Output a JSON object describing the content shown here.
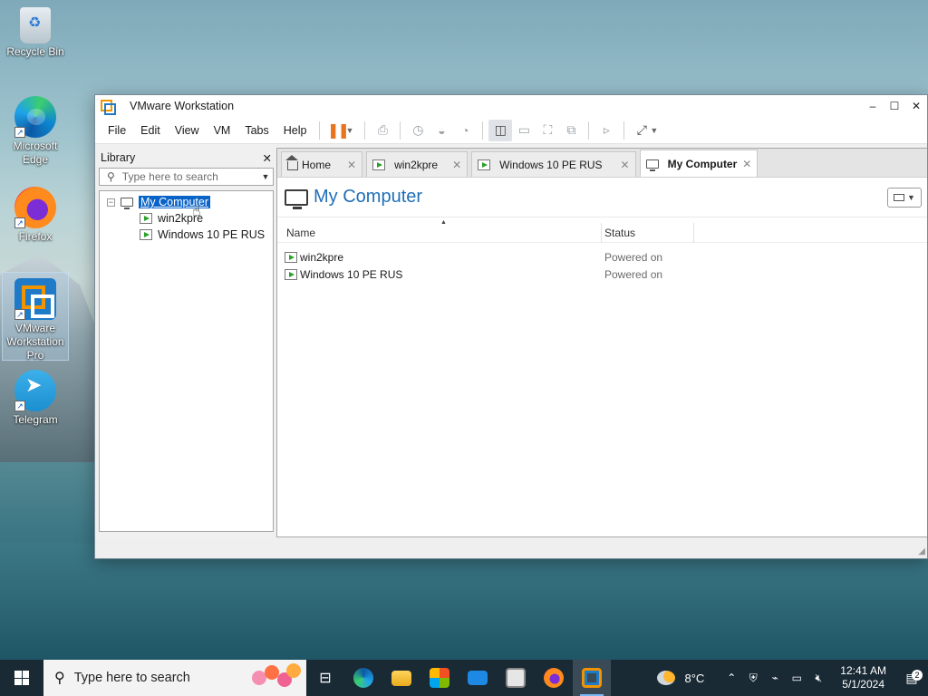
{
  "desktop": {
    "icons": [
      {
        "label": "Recycle Bin"
      },
      {
        "label": "Microsoft Edge"
      },
      {
        "label": "Firefox"
      },
      {
        "label": "VMware Workstation Pro"
      },
      {
        "label": "Telegram"
      }
    ]
  },
  "window": {
    "title": "VMware Workstation",
    "controls": {
      "minimize": "–",
      "maximize": "☐",
      "close": "✕"
    }
  },
  "menu": [
    "File",
    "Edit",
    "View",
    "VM",
    "Tabs",
    "Help"
  ],
  "library": {
    "title": "Library",
    "close": "✕",
    "search_placeholder": "Type here to search",
    "tree": {
      "root": "My Computer",
      "children": [
        "win2kpre",
        "Windows 10 PE RUS"
      ]
    }
  },
  "tabs": [
    {
      "label": "Home",
      "close": "✕"
    },
    {
      "label": "win2kpre",
      "close": "✕"
    },
    {
      "label": "Windows 10 PE RUS",
      "close": "✕"
    },
    {
      "label": "My Computer",
      "close": "✕",
      "active": true
    }
  ],
  "page": {
    "title": "My Computer",
    "columns": [
      "Name",
      "Status"
    ],
    "rows": [
      {
        "name": "win2kpre",
        "status": "Powered on"
      },
      {
        "name": "Windows 10 PE RUS",
        "status": "Powered on"
      }
    ]
  },
  "taskbar": {
    "search_placeholder": "Type here to search",
    "weather_temp": "8°C",
    "time": "12:41 AM",
    "date": "5/1/2024",
    "notification_count": "2"
  },
  "colors": {
    "accent": "#1f6fb8",
    "selection": "#0a64c8",
    "pause": "#e8741e",
    "vm_running": "#2aa12a"
  }
}
